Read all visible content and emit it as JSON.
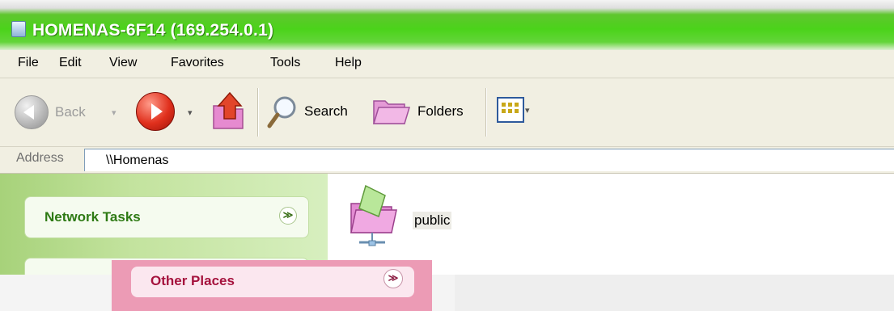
{
  "window": {
    "title": "HOMENAS-6F14 (169.254.0.1)",
    "title_icon": "network-drive-icon"
  },
  "menu": {
    "items": [
      "File",
      "Edit",
      "View",
      "Favorites",
      "Tools",
      "Help"
    ]
  },
  "toolbar": {
    "back_label": "Back",
    "search_label": "Search",
    "folders_label": "Folders",
    "caret": "▾"
  },
  "address": {
    "label": "Address",
    "value": "\\\\Homenas"
  },
  "task_pane": {
    "sections": [
      {
        "label": "Network Tasks",
        "toggle": "≫"
      },
      {
        "label": "Other Places",
        "toggle": "≫"
      }
    ]
  },
  "content": {
    "items": [
      {
        "label": "public",
        "icon": "shared-folder-icon"
      }
    ]
  },
  "colors": {
    "title_green": "#4bd31a",
    "task_pane_green": "#a7d27a",
    "task_header_text": "#2e7a14",
    "glitch_pink": "#ec9bb5",
    "glitch_header_text": "#a5123d"
  }
}
